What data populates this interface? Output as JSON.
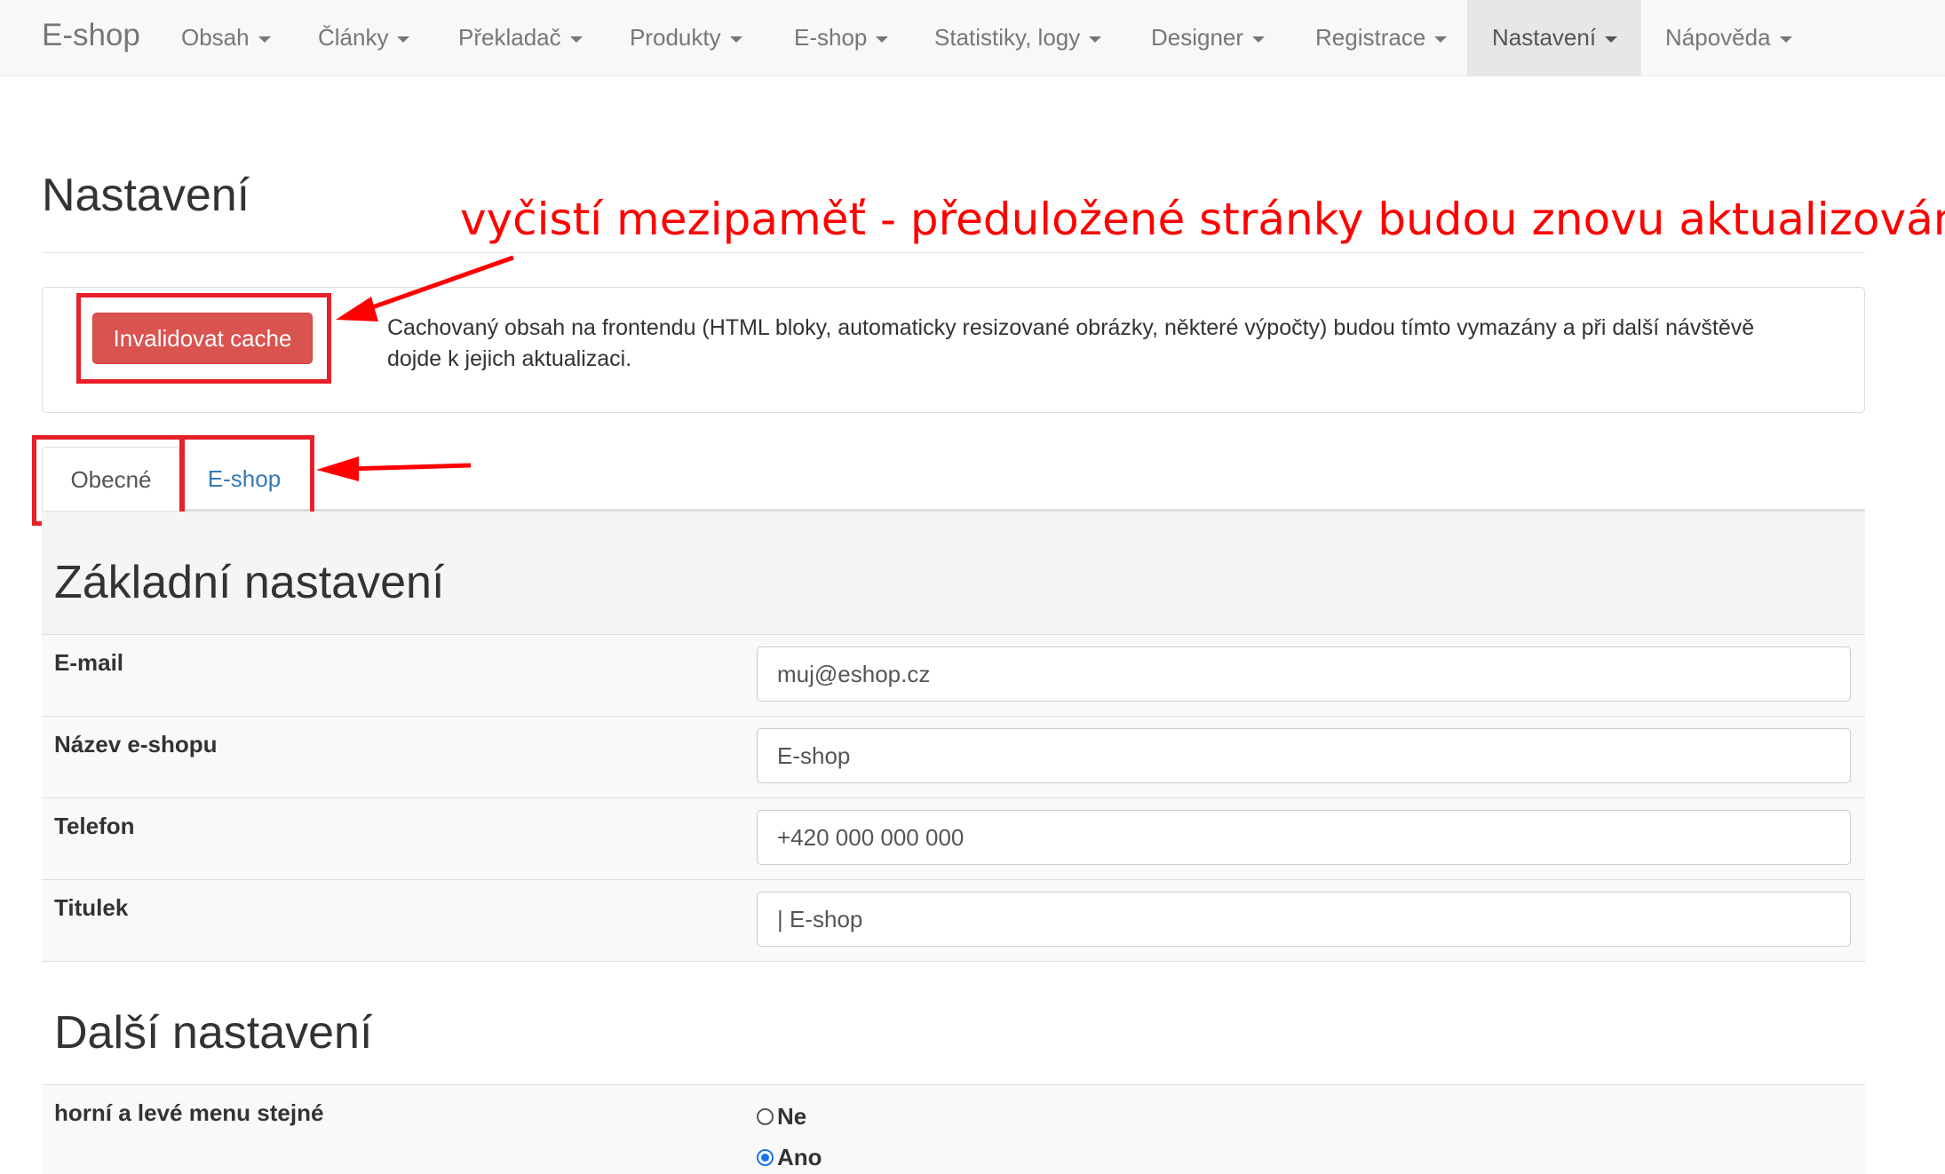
{
  "navbar": {
    "brand": "E-shop",
    "items": [
      {
        "label": "Obsah"
      },
      {
        "label": "Články"
      },
      {
        "label": "Překladač"
      },
      {
        "label": "Produkty"
      },
      {
        "label": "E-shop"
      },
      {
        "label": "Statistiky, logy"
      },
      {
        "label": "Designer"
      },
      {
        "label": "Registrace"
      },
      {
        "label": "Nastavení",
        "active": true
      },
      {
        "label": "Nápověda"
      }
    ]
  },
  "page": {
    "title": "Nastavení",
    "annotation": "vyčistí mezipaměť - předuložené stránky budou znovu aktualizovány"
  },
  "cache": {
    "button_label": "Invalidovat cache",
    "description": "Cachovaný obsah na frontendu (HTML bloky, automaticky resizované obrázky, některé výpočty) budou tímto vymazány a při další návštěvě dojde k jejich aktualizaci."
  },
  "tabs": [
    {
      "label": "Obecné",
      "active": true
    },
    {
      "label": "E-shop",
      "active": false
    }
  ],
  "basic_settings": {
    "heading": "Základní nastavení",
    "fields": [
      {
        "label": "E-mail",
        "value": "muj@eshop.cz"
      },
      {
        "label": "Název e-shopu",
        "value": "E-shop"
      },
      {
        "label": "Telefon",
        "value": "+420 000 000 000"
      },
      {
        "label": "Titulek",
        "value": "| E-shop"
      }
    ]
  },
  "other_settings": {
    "heading": "Další nastavení",
    "fields": [
      {
        "label": "horní a levé menu stejné",
        "options": [
          "Ne",
          "Ano"
        ],
        "selected": "Ano"
      }
    ]
  },
  "colors": {
    "annotation_red": "#ff0000",
    "danger": "#d9534f",
    "link": "#337ab7"
  }
}
